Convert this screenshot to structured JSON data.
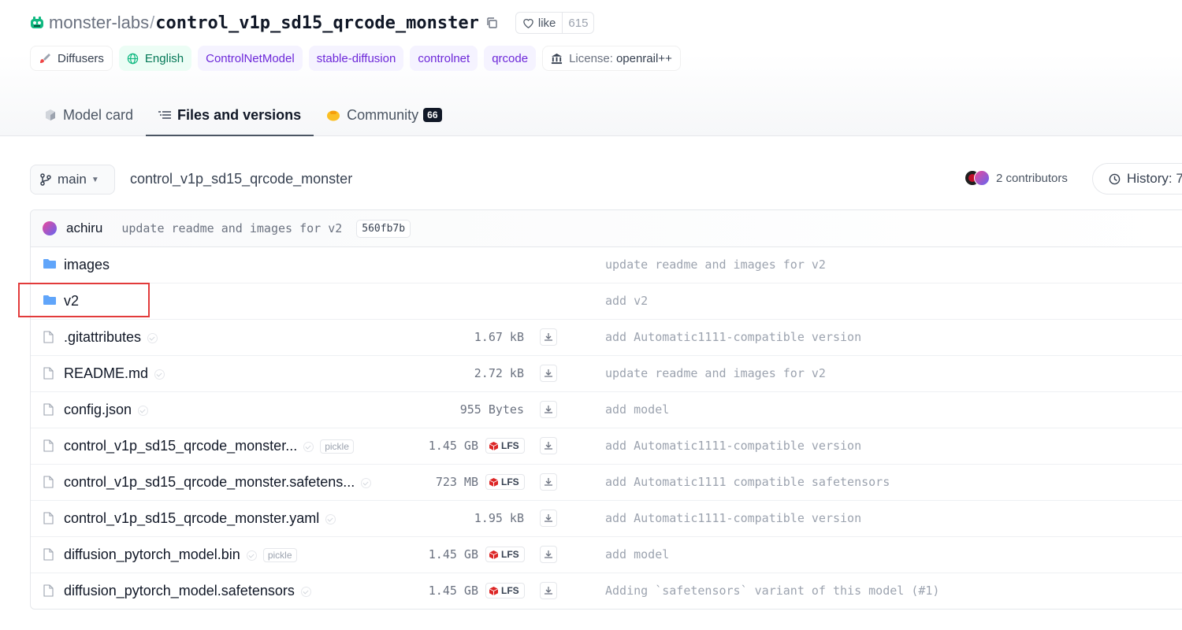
{
  "repo": {
    "org": "monster-labs",
    "separator": "/",
    "name": "control_v1p_sd15_qrcode_monster",
    "like_label": "like",
    "like_count": "615"
  },
  "tags": {
    "library": "Diffusers",
    "language": "English",
    "model_type": "ControlNetModel",
    "t1": "stable-diffusion",
    "t2": "controlnet",
    "t3": "qrcode",
    "license_key": "License:",
    "license_value": "openrail++"
  },
  "tabs": {
    "model_card": "Model card",
    "files": "Files and versions",
    "community": "Community",
    "community_count": "66"
  },
  "toolbar": {
    "branch": "main",
    "path": "control_v1p_sd15_qrcode_monster",
    "contributors": "2 contributors",
    "history": "History: 7"
  },
  "last_commit": {
    "author": "achiru",
    "message": "update readme and images for v2",
    "hash": "560fb7b"
  },
  "files": [
    {
      "name": "images",
      "type": "folder",
      "commit": "update readme and images for v2"
    },
    {
      "name": "v2",
      "type": "folder",
      "commit": "add v2"
    },
    {
      "name": ".gitattributes",
      "type": "file",
      "size": "1.67 kB",
      "commit": "add Automatic1111-compatible version"
    },
    {
      "name": "README.md",
      "type": "file",
      "size": "2.72 kB",
      "commit": "update readme and images for v2"
    },
    {
      "name": "config.json",
      "type": "file",
      "size": "955 Bytes",
      "commit": "add model"
    },
    {
      "name": "control_v1p_sd15_qrcode_monster...",
      "type": "file",
      "pickle": "pickle",
      "size": "1.45 GB",
      "lfs": "LFS",
      "commit": "add Automatic1111-compatible version"
    },
    {
      "name": "control_v1p_sd15_qrcode_monster.safetens...",
      "type": "file",
      "size": "723 MB",
      "lfs": "LFS",
      "commit": "add Automatic1111 compatible safetensors"
    },
    {
      "name": "control_v1p_sd15_qrcode_monster.yaml",
      "type": "file",
      "size": "1.95 kB",
      "commit": "add Automatic1111-compatible version"
    },
    {
      "name": "diffusion_pytorch_model.bin",
      "type": "file",
      "pickle": "pickle",
      "size": "1.45 GB",
      "lfs": "LFS",
      "commit": "add model"
    },
    {
      "name": "diffusion_pytorch_model.safetensors",
      "type": "file",
      "size": "1.45 GB",
      "lfs": "LFS",
      "commit": "Adding `safetensors` variant of this model (#1)"
    }
  ],
  "colors": {
    "accent_purple": "#6d28d9",
    "accent_green": "#047857",
    "folder_blue": "#60a5fa",
    "lfs_red": "#dc2626",
    "highlight_red": "#e23b3b"
  },
  "icons": {
    "org": "robot-icon",
    "copy": "copy-icon",
    "like": "heart-icon",
    "folder": "folder-icon",
    "file": "file-icon",
    "download": "download-icon"
  }
}
